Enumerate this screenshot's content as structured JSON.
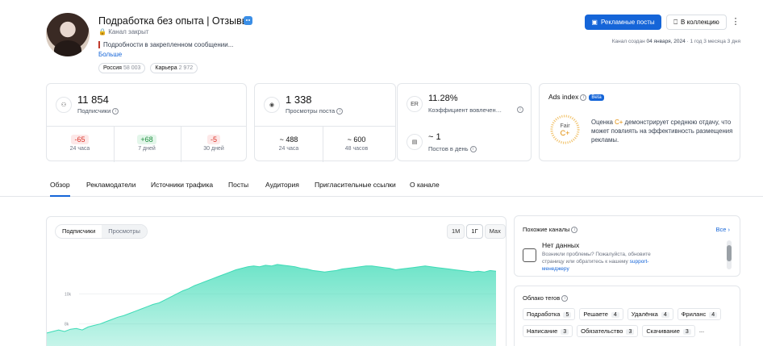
{
  "channel": {
    "title": "Подработка без опыта | Отзывы",
    "status": "Канал закрыт",
    "description": "Подробности в закрепленном сообщении...",
    "more_link": "Больше",
    "tags": [
      {
        "name": "Россия",
        "count": "58 003"
      },
      {
        "name": "Карьера",
        "count": "2 972"
      }
    ]
  },
  "header_actions": {
    "ads_posts": "Рекламные посты",
    "add_collection": "В коллекцию",
    "menu": "⋮"
  },
  "created": {
    "label": "Канал создан",
    "date": "04 января, 2024",
    "age": "· 1 год 3 месяца 3 дня"
  },
  "stats": {
    "subscribers": {
      "icon": "users-icon",
      "value": "11 854",
      "label": "Подписчики",
      "deltas": [
        {
          "value": "-65",
          "period": "24 часа",
          "sign": "neg"
        },
        {
          "value": "+68",
          "period": "7 дней",
          "sign": "pos"
        },
        {
          "value": "-5",
          "period": "30 дней",
          "sign": "neg"
        }
      ]
    },
    "views": {
      "icon": "eye-icon",
      "value": "1 338",
      "label": "Просмотры поста",
      "sub": [
        {
          "value": "~ 488",
          "period": "24 часа"
        },
        {
          "value": "~ 600",
          "period": "48 часов"
        }
      ]
    },
    "er": {
      "icon_text": "ER",
      "value": "11.28%",
      "label": "Коэффициент вовлечен…"
    },
    "posts": {
      "icon": "document-icon",
      "value": "~ 1",
      "label": "Постов в день"
    },
    "ads_index": {
      "title": "Ads index",
      "beta": "Beta",
      "fair": "Fair",
      "grade": "C+",
      "desc_before": "Оценка ",
      "desc_grade": "C+",
      "desc_after": " демонстрирует среднюю отдачу, что может повлиять на эффективность размещения рекламы.",
      "color": "#e08a00"
    }
  },
  "tabs": [
    {
      "label": "Обзор",
      "active": true
    },
    {
      "label": "Рекламодатели"
    },
    {
      "label": "Источники трафика"
    },
    {
      "label": "Посты"
    },
    {
      "label": "Аудитория"
    },
    {
      "label": "Пригласительные ссылки"
    },
    {
      "label": "О канале"
    }
  ],
  "chart_panel": {
    "toggle": [
      "Подписчики",
      "Просмотры"
    ],
    "periods": [
      "1M",
      "1Г",
      "Max"
    ],
    "active_period": "1Г"
  },
  "chart_data": {
    "type": "area",
    "xlabel": "",
    "ylabel": "",
    "ylim": [
      6000,
      13500
    ],
    "ticks": [
      {
        "value": 10000,
        "label": "10k"
      },
      {
        "value": 8000,
        "label": "8k"
      }
    ],
    "values": [
      7400,
      7500,
      7600,
      7500,
      7650,
      7700,
      7600,
      7800,
      7900,
      8000,
      8150,
      8300,
      8450,
      8550,
      8700,
      8850,
      9000,
      9150,
      9300,
      9400,
      9600,
      9800,
      10000,
      10200,
      10350,
      10550,
      10700,
      10850,
      11000,
      11150,
      11300,
      11450,
      11600,
      11700,
      11800,
      11850,
      11800,
      11900,
      11850,
      11950,
      11900,
      11850,
      11800,
      11700,
      11650,
      11550,
      11500,
      11450,
      11500,
      11550,
      11650,
      11700,
      11750,
      11800,
      11850,
      11850,
      11800,
      11750,
      11700,
      11600,
      11650,
      11700,
      11750,
      11800,
      11850,
      11800,
      11750,
      11700,
      11650,
      11600,
      11550,
      11500,
      11450,
      11500,
      11450,
      11550,
      11500
    ],
    "color": "#3ddbb6"
  },
  "similar": {
    "title": "Похожие каналы",
    "all_link": "Все",
    "nodata_title": "Нет данных",
    "nodata_text": "Возникли проблемы? Пожалуйста, обновите страницу или обратитесь к нашему ",
    "support_link": "support-менеджеру"
  },
  "tag_cloud": {
    "title": "Облако тегов",
    "tags": [
      {
        "name": "Подработка",
        "count": "5"
      },
      {
        "name": "Решаете",
        "count": "4"
      },
      {
        "name": "Удалёнка",
        "count": "4"
      },
      {
        "name": "Фриланс",
        "count": "4"
      },
      {
        "name": "Написание",
        "count": "3"
      },
      {
        "name": "Обязательство",
        "count": "3"
      },
      {
        "name": "Скачивание",
        "count": "3"
      }
    ],
    "ellipsis": "..."
  }
}
